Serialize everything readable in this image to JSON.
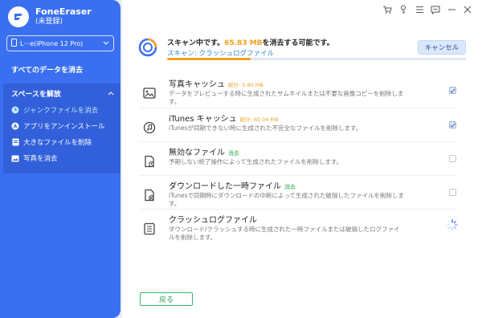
{
  "app": {
    "name": "FoneEraser",
    "subtitle": "(未登録)"
  },
  "device": {
    "label": "L···e(iPhone 12 Pro)"
  },
  "sidebar": {
    "erase_all": "すべてのデータを消去",
    "group_title": "スペースを解放",
    "items": [
      {
        "label": "ジャンクファイルを消去",
        "icon": "clock-icon",
        "active": true
      },
      {
        "label": "アプリをアンインストール",
        "icon": "app-store-icon",
        "active": false
      },
      {
        "label": "大きなファイルを削除",
        "icon": "file-icon",
        "active": false
      },
      {
        "label": "写真を消去",
        "icon": "photo-icon",
        "active": false
      }
    ]
  },
  "scan": {
    "title_prefix": "スキャン中です。",
    "size": "65.83 MB",
    "title_suffix": "を消去する可能です。",
    "status": "スキャン: クラッシュログファイル",
    "progress": 0.28,
    "cancel_label": "キャンセル"
  },
  "rows": [
    {
      "title": "写真キャッシュ",
      "size": "総計: 5.80 MB",
      "tag": "",
      "desc": "データをプレビューする時に生成されたサムネイルまたは不要な画像コピーを削除します。",
      "state": "checked",
      "icon": "image-icon"
    },
    {
      "title": "iTunes キャッシュ",
      "size": "総計: 60.04 MB",
      "tag": "",
      "desc": "iTunesが同期できない時に生成された不完全なファイルを削除します。",
      "state": "checked",
      "icon": "music-icon"
    },
    {
      "title": "無効なファイル",
      "size": "",
      "tag": "消去",
      "desc": "予期しない終了操作によって生成されたファイルを削除します。",
      "state": "unchecked",
      "icon": "invalid-file-icon"
    },
    {
      "title": "ダウンロードした一時ファイル",
      "size": "",
      "tag": "消去",
      "desc": "iTunesで同期時にダウンロードの中断によって生成された破損したファイルを削除します。",
      "state": "unchecked",
      "icon": "download-file-icon"
    },
    {
      "title": "クラッシュログファイル",
      "size": "",
      "tag": "",
      "desc": "ダウンロード/クラッシュする時に生成された一時ファイルまたは破損したログファイルを削除します。",
      "state": "loading",
      "icon": "log-file-icon"
    }
  ],
  "footer": {
    "back_label": "戻る"
  },
  "colors": {
    "sidebar": "#3a6ff0",
    "accent_orange": "#f0a020",
    "status_blue": "#2a8bd0",
    "tag_green": "#28a745"
  }
}
